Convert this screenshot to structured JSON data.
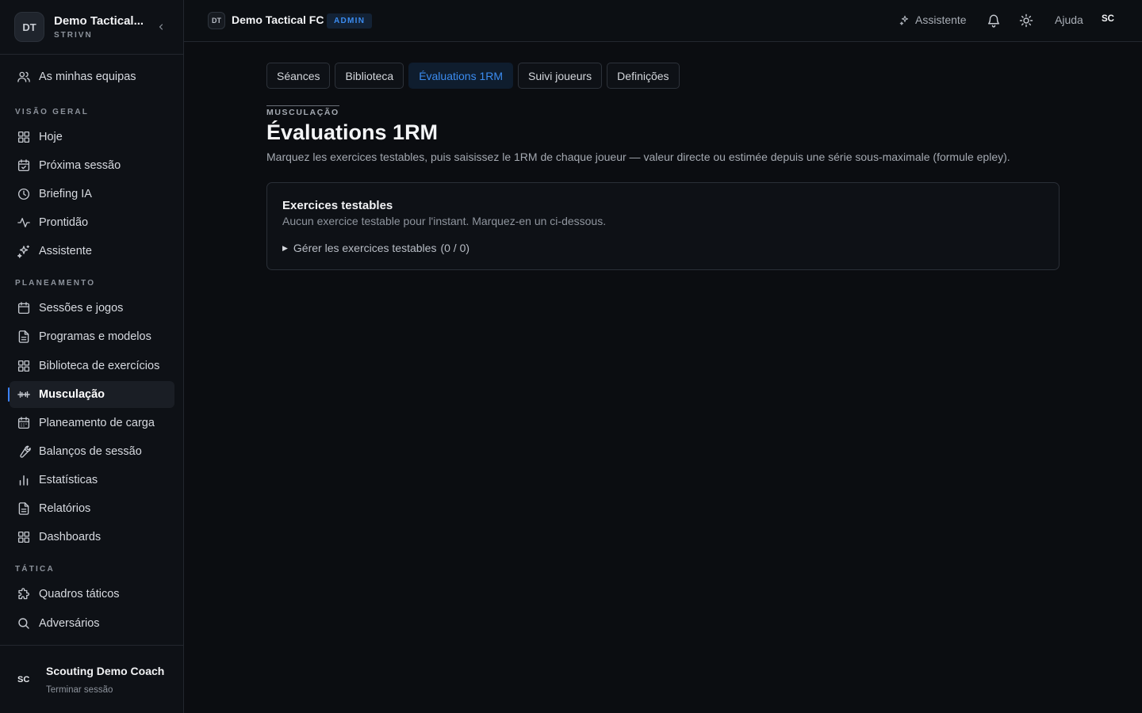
{
  "sidebar": {
    "team": {
      "avatar": "DT",
      "name": "Demo Tactical...",
      "org": "STRIVN"
    },
    "my_teams": "As minhas equipas",
    "sections": [
      {
        "label": "VISÃO GERAL",
        "items": [
          "Hoje",
          "Próxima sessão",
          "Briefing IA",
          "Prontidão",
          "Assistente"
        ]
      },
      {
        "label": "PLANEAMENTO",
        "items": [
          "Sessões e jogos",
          "Programas e modelos",
          "Biblioteca de exercícios",
          "Musculação",
          "Planeamento de carga",
          "Balanços de sessão",
          "Estatísticas",
          "Relatórios",
          "Dashboards"
        ]
      },
      {
        "label": "TÁTICA",
        "items": [
          "Quadros táticos",
          "Adversários"
        ]
      }
    ],
    "active_item": "Musculação",
    "user": {
      "initials": "SC",
      "name": "Scouting Demo Coach",
      "logout": "Terminar sessão"
    }
  },
  "topbar": {
    "club_badge": "DT",
    "club_name": "Demo Tactical FC",
    "role_badge": "ADMIN",
    "assistant": "Assistente",
    "help": "Ajuda",
    "user_initials": "SC"
  },
  "tabs": [
    {
      "label": "Séances",
      "active": false
    },
    {
      "label": "Biblioteca",
      "active": false
    },
    {
      "label": "Évaluations 1RM",
      "active": true
    },
    {
      "label": "Suivi joueurs",
      "active": false
    },
    {
      "label": "Definições",
      "active": false
    }
  ],
  "page": {
    "eyebrow": "MUSCULAÇÃO",
    "title": "Évaluations 1RM",
    "description": "Marquez les exercices testables, puis saisissez le 1RM de chaque joueur — valeur directe ou estimée depuis une série sous-maximale (formule epley)."
  },
  "card": {
    "title": "Exercices testables",
    "subtitle": "Aucun exercice testable pour l'instant. Marquez-en un ci-dessous.",
    "toggle": "Gérer les exercices testables",
    "count": "(0 / 0)"
  },
  "colors": {
    "accent": "#3b8cf0",
    "background": "#0b0d11",
    "sidebar": "#0e1116"
  }
}
